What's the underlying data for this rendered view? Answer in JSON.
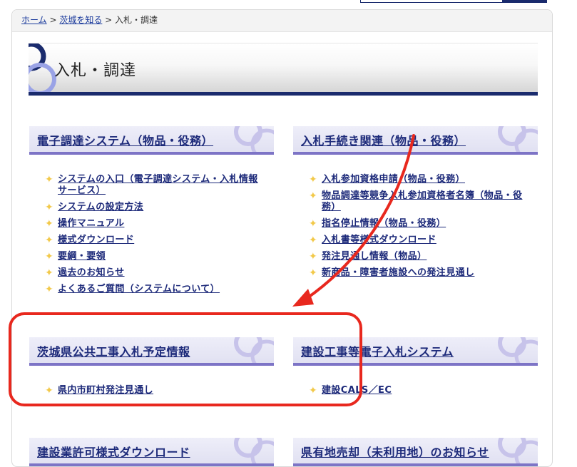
{
  "breadcrumb": {
    "home": "ホーム",
    "sep1": " > ",
    "parent": "茨城を知る",
    "sep2": " > ",
    "current": "入札・調達"
  },
  "page_title": "入札・調達",
  "sections": [
    {
      "heading": "電子調達システム（物品・役務）",
      "items": [
        "システムの入口（電子調達システム・入札情報サービス）",
        "システムの設定方法",
        "操作マニュアル",
        "様式ダウンロード",
        "要綱・要領",
        "過去のお知らせ",
        "よくあるご質問（システムについて）"
      ]
    },
    {
      "heading": "入札手続き関連（物品・役務）",
      "items": [
        "入札参加資格申請（物品・役務）",
        "物品調達等競争入札参加資格者名簿（物品・役務）",
        "指名停止情報（物品・役務）",
        "入札書等様式ダウンロード",
        "発注見通し情報（物品）",
        "新商品・障害者施設への発注見通し"
      ]
    },
    {
      "heading": "茨城県公共工事入札予定情報",
      "items": [
        "県内市町村発注見通し"
      ]
    },
    {
      "heading": "建設工事等電子入札システム",
      "items": [
        "建設CALS／EC"
      ]
    },
    {
      "heading": "建設業許可様式ダウンロード",
      "items": []
    },
    {
      "heading": "県有地売却（未利用地）のお知らせ",
      "items": []
    }
  ],
  "bullet_glyph": "✦",
  "annotation": {
    "arrow_color": "#e8281e",
    "highlight_color": "#e8281e"
  }
}
